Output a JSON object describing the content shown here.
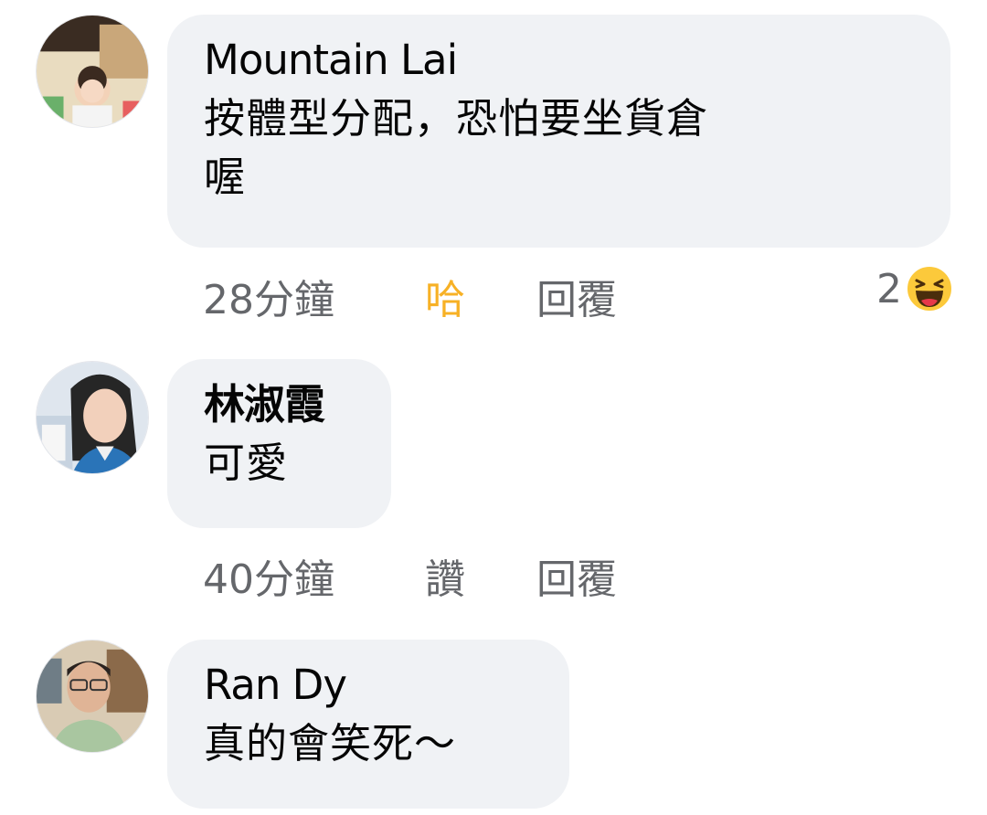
{
  "comments": [
    {
      "author": "Mountain Lai",
      "text_line1": "按體型分配，恐怕要坐貨倉",
      "text_line2": "喔",
      "time": "28分鐘",
      "reaction_label": "哈",
      "reply_label": "回覆",
      "reaction_count": "2",
      "reaction_icon": "haha-emoji-icon"
    },
    {
      "author": "林淑霞",
      "text": "可愛",
      "time": "40分鐘",
      "reaction_label": "讚",
      "reply_label": "回覆"
    },
    {
      "author": "Ran Dy",
      "text": "真的會笑死～"
    }
  ],
  "colors": {
    "bubble": "#f0f2f5",
    "meta_text": "#65676b",
    "haha_accent": "#f7b125"
  }
}
